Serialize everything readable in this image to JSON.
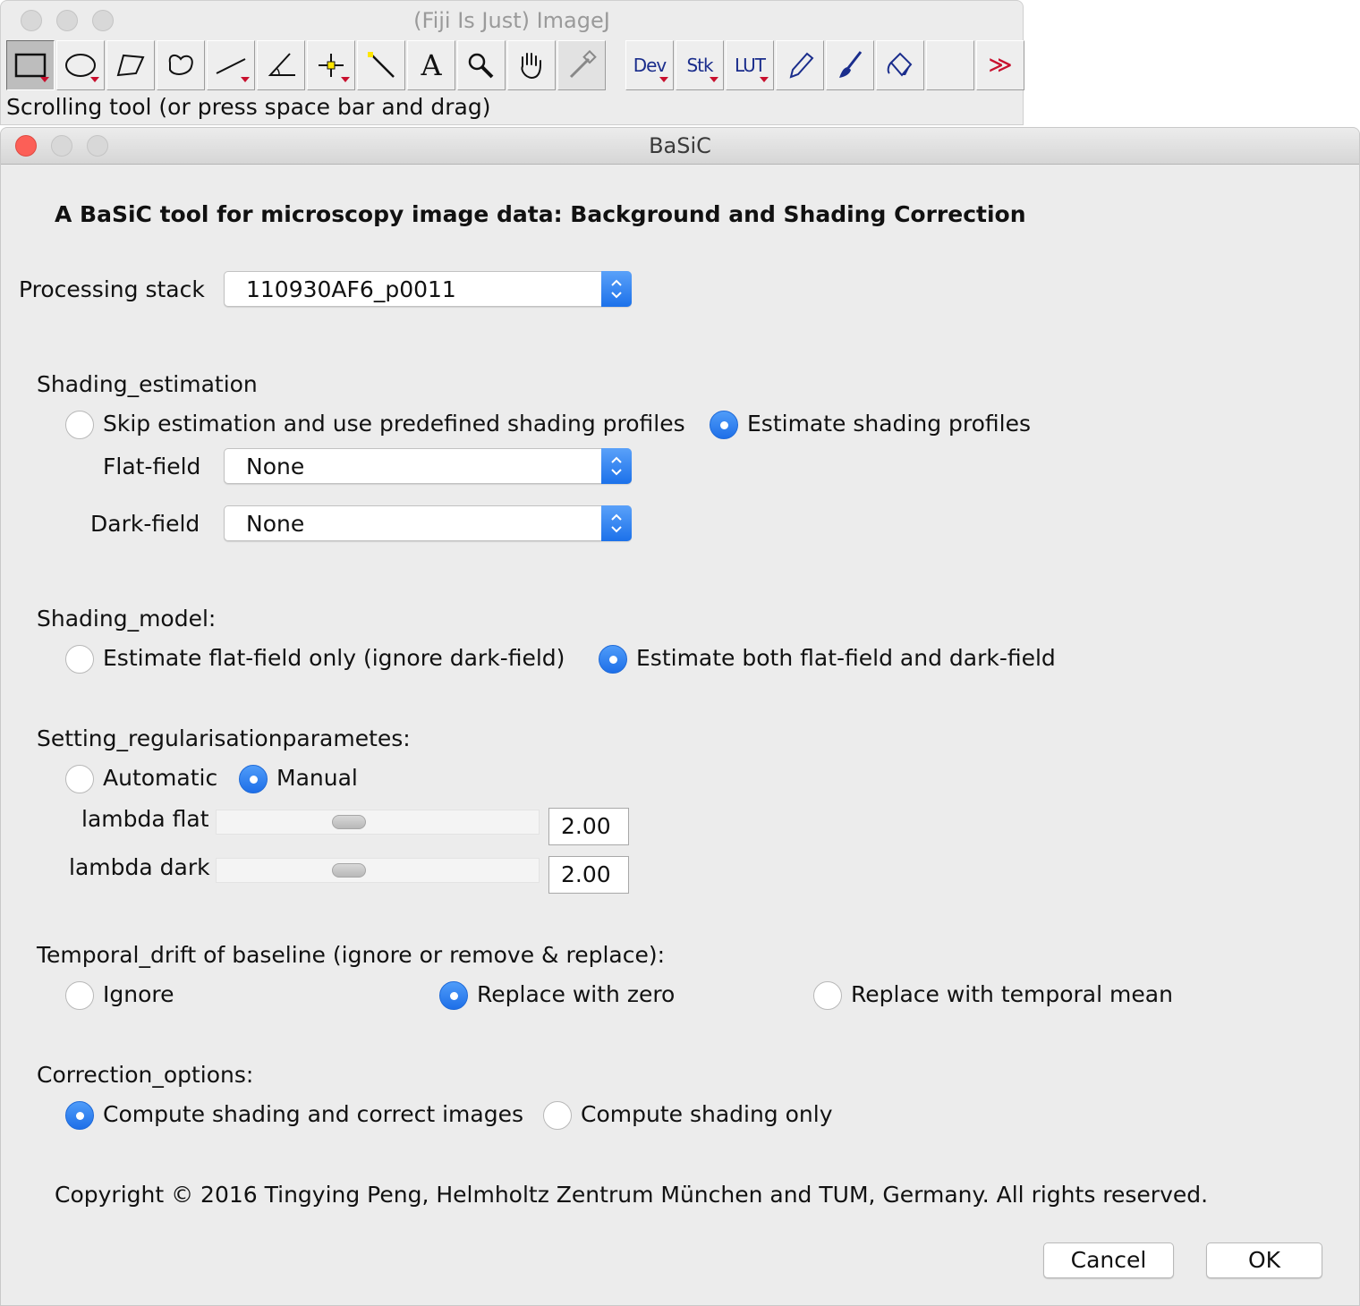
{
  "imagej": {
    "title": "(Fiji Is Just) ImageJ",
    "status": "Scrolling tool (or press space bar and drag)",
    "tools": [
      {
        "name": "rectangle-tool-icon"
      },
      {
        "name": "oval-tool-icon"
      },
      {
        "name": "polygon-tool-icon"
      },
      {
        "name": "freehand-tool-icon"
      },
      {
        "name": "line-tool-icon"
      },
      {
        "name": "angle-tool-icon"
      },
      {
        "name": "point-tool-icon"
      },
      {
        "name": "wand-tool-icon"
      },
      {
        "name": "text-tool-icon",
        "label": "A"
      },
      {
        "name": "magnifier-tool-icon"
      },
      {
        "name": "hand-tool-icon"
      },
      {
        "name": "color-picker-tool-icon"
      },
      {
        "name": "dev-menu-icon",
        "label": "Dev"
      },
      {
        "name": "stk-menu-icon",
        "label": "Stk"
      },
      {
        "name": "lut-menu-icon",
        "label": "LUT"
      },
      {
        "name": "pencil-tool-icon"
      },
      {
        "name": "brush-tool-icon"
      },
      {
        "name": "flood-fill-tool-icon"
      },
      {
        "name": "empty-tool-slot"
      },
      {
        "name": "more-tools-icon",
        "label": "≫"
      }
    ]
  },
  "basic": {
    "title": "BaSiC",
    "heading": "A BaSiC tool for microscopy image data: Background and Shading Correction",
    "processing_stack": {
      "label": "Processing stack",
      "value": "110930AF6_p0011"
    },
    "shading_estimation": {
      "heading": "Shading_estimation",
      "options": [
        "Skip estimation and use predefined shading profiles",
        "Estimate shading profiles"
      ],
      "selected": 1,
      "flat_field": {
        "label": "Flat-field",
        "value": "None"
      },
      "dark_field": {
        "label": "Dark-field",
        "value": "None"
      }
    },
    "shading_model": {
      "heading": "Shading_model:",
      "options": [
        "Estimate flat-field only (ignore dark-field)",
        "Estimate both flat-field and dark-field"
      ],
      "selected": 1
    },
    "regularisation": {
      "heading": "Setting_regularisationparametes:",
      "options": [
        "Automatic",
        "Manual"
      ],
      "selected": 1,
      "lambda_flat": {
        "label": "lambda flat",
        "value": "2.00",
        "slider_fraction": 0.41
      },
      "lambda_dark": {
        "label": "lambda dark",
        "value": "2.00",
        "slider_fraction": 0.41
      }
    },
    "temporal_drift": {
      "heading": "Temporal_drift of baseline (ignore or remove & replace):",
      "options": [
        "Ignore",
        "Replace with zero",
        "Replace with temporal mean"
      ],
      "selected": 1
    },
    "correction_options": {
      "heading": "Correction_options:",
      "options": [
        "Compute shading and correct images",
        "Compute shading only"
      ],
      "selected": 0
    },
    "copyright": "Copyright © 2016 Tingying Peng, Helmholtz Zentrum München and TUM, Germany. All rights reserved.",
    "buttons": {
      "cancel": "Cancel",
      "ok": "OK"
    }
  },
  "colors": {
    "accent_blue": "#2a7bef",
    "close_red": "#fc5f57",
    "dropdown_red": "#c8102e",
    "window_bg": "#ececec"
  }
}
